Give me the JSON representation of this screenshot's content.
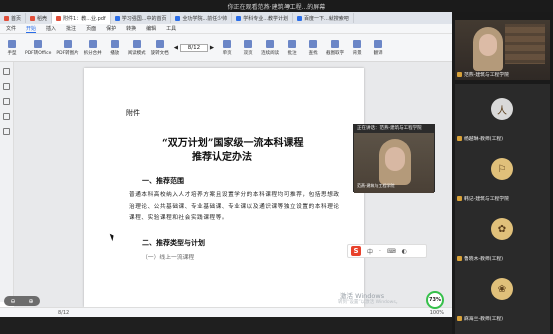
{
  "topbar": {
    "title": "你正在观看范燕·建筑与工程...的屏幕"
  },
  "app": {
    "tabs": [
      {
        "label": "首页",
        "color": "#e04e3a",
        "active": false
      },
      {
        "label": "稻壳",
        "color": "#e04e3a",
        "active": false
      },
      {
        "label": "附件1：教...业.pdf",
        "color": "#e04e3a",
        "active": true
      },
      {
        "label": "学习强国...中的首页",
        "color": "#2a6de8",
        "active": false
      },
      {
        "label": "全功学院...前任少帅",
        "color": "#2a6de8",
        "active": false
      },
      {
        "label": "学科专业...教学计划",
        "color": "#2a6de8",
        "active": false
      },
      {
        "label": "百度一下...就搜索吧",
        "color": "#2a6de8",
        "active": false
      }
    ],
    "menu": [
      "文件",
      "开始",
      "插入",
      "批注",
      "页面",
      "保护",
      "转换",
      "编辑",
      "工具"
    ],
    "menu_active": "开始",
    "ribbon": [
      "手型",
      "PDF转Office",
      "PDF转图片",
      "拆分合并",
      "播放",
      "阅读模式",
      "旋转文档",
      "单页",
      "双页",
      "连续阅读",
      "批注",
      "查找",
      "截图取字",
      "背景",
      "翻译",
      "压缩"
    ],
    "page_indicator": "8/12",
    "zoom": "连续阅读",
    "status_page": "8/12",
    "status_zoom": "100%",
    "doc": {
      "attachment": "附件",
      "title1": "“双万计划”国家级一流本科课程",
      "title2": "推荐认定办法",
      "section1": "一、推荐范围",
      "para1": "普通本科高校纳入人才培养方案且设置学分的本科课程均可推荐，包括思想政治理论、公共基础课、专业基础课、专业课以及通识课等独立设置的本科理论课程、实验课程和社会实践课程等。",
      "section2": "二、推荐类型与计划",
      "section3": "（一）线上一流课程"
    },
    "pip": {
      "label": "正在讲话：范燕-建筑与工程学院",
      "name": "范燕-建筑与工程学院"
    },
    "toolbox": {
      "logo": "S",
      "items": [
        "中",
        "·",
        "⌨",
        "◐"
      ]
    },
    "watermark": "激活 Windows",
    "watermark_sub": "转到“设置”以激活 Windows。",
    "speed": "73%"
  },
  "participants": [
    {
      "name": "范燕-建筑与工程学院",
      "mic": "#d8a23a"
    },
    {
      "name": "杨越琳-教师(工程)",
      "mic": "#d8a23a",
      "avatar_bg": "#d9d9d9",
      "avatar": "人"
    },
    {
      "name": "韩记-建筑与工程学院",
      "mic": "#d8a23a",
      "avatar_bg": "#e0c07a",
      "avatar": "⚐"
    },
    {
      "name": "鲁晓木-教师(工程)",
      "mic": "#d8a23a",
      "avatar_bg": "#e0c07a",
      "avatar": "✿"
    },
    {
      "name": "麻海兰-教师(工程)",
      "mic": "#d8a23a",
      "avatar_bg": "#e0c07a",
      "avatar": "❀"
    },
    {
      "name": "",
      "mic": "#d8a23a",
      "avatar_bg": "#f1e5d3",
      "avatar": ""
    }
  ]
}
